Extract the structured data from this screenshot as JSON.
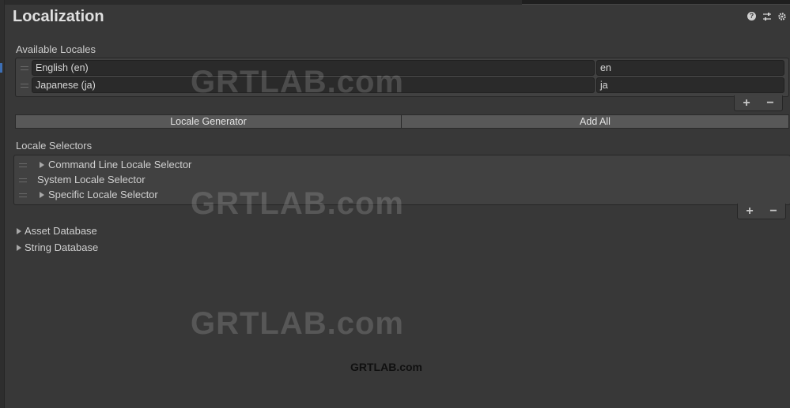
{
  "window": {
    "title": "Localization"
  },
  "header_icons": [
    "help-icon",
    "preset-sliders-icon",
    "gear-icon"
  ],
  "available_locales": {
    "label": "Available Locales",
    "rows": [
      {
        "name": "English (en)",
        "code": "en"
      },
      {
        "name": "Japanese (ja)",
        "code": "ja"
      }
    ],
    "add_symbol": "+",
    "remove_symbol": "−"
  },
  "buttons": {
    "locale_generator": "Locale Generator",
    "add_all": "Add All"
  },
  "locale_selectors": {
    "label": "Locale Selectors",
    "items": [
      {
        "label": "Command Line Locale Selector",
        "expandable": true
      },
      {
        "label": "System Locale Selector",
        "expandable": false
      },
      {
        "label": "Specific Locale Selector",
        "expandable": true
      }
    ],
    "add_symbol": "+",
    "remove_symbol": "−"
  },
  "foldouts": [
    "Asset Database",
    "String Database"
  ],
  "watermark": {
    "large": "GRTLAB.com",
    "small": "GRTLAB.com"
  },
  "colors": {
    "background": "#383838",
    "field": "#2a2a2a",
    "button": "#585858",
    "accent": "#3d6fb5"
  }
}
